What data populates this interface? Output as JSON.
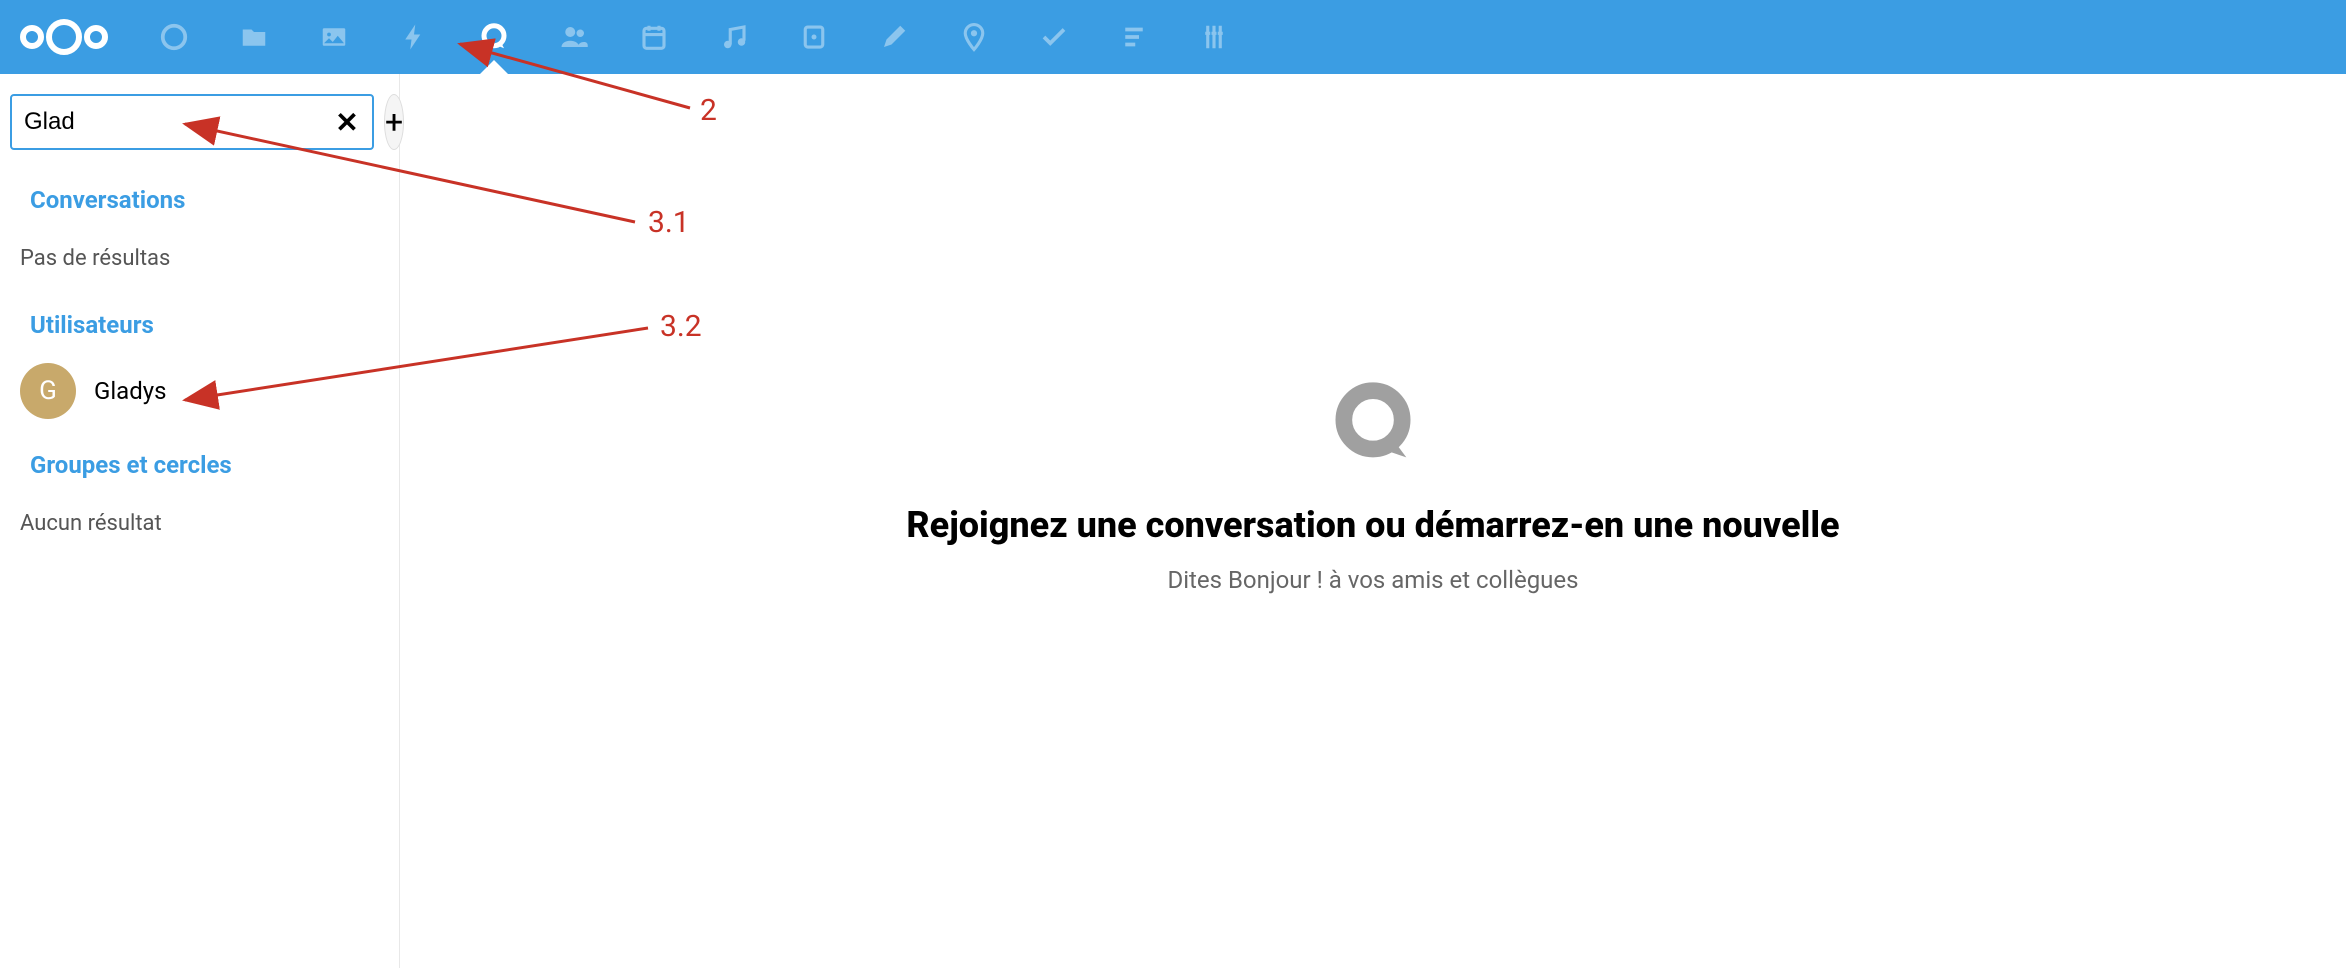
{
  "search": {
    "value": "Glad"
  },
  "sidebar": {
    "sections": {
      "conversations": {
        "title": "Conversations",
        "empty": "Pas de résultas"
      },
      "users": {
        "title": "Utilisateurs",
        "items": [
          {
            "initial": "G",
            "name": "Gladys"
          }
        ]
      },
      "groups": {
        "title": "Groupes et cercles",
        "empty": "Aucun résultat"
      }
    }
  },
  "main": {
    "title": "Rejoignez une conversation ou démarrez-en une nouvelle",
    "subtitle": "Dites Bonjour ! à vos amis et collègues"
  },
  "annotations": {
    "a2": "2",
    "a31": "3.1",
    "a32": "3.2"
  }
}
